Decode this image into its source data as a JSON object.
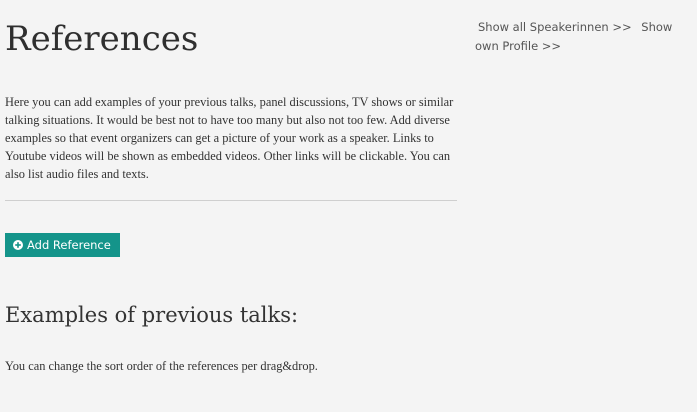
{
  "page": {
    "title": "References",
    "intro": "Here you can add examples of your previous talks, panel discussions, TV shows or similar talking situations. It would be best not to have too many but also not too few. Add diverse examples so that event organizers can get a picture of your work as a speaker. Links to Youtube videos will be shown as embedded videos. Other links will be clickable. You can also list audio files and texts.",
    "add_button_label": "Add Reference",
    "section_title": "Examples of previous talks:",
    "sort_hint": "You can change the sort order of the references per drag&drop."
  },
  "sidebar": {
    "show_all_link": "Show all Speakerinnen >>",
    "show_profile_link": "Show own Profile >>"
  },
  "icons": {
    "add_button_icon": "plus-circle-icon"
  },
  "colors": {
    "button_background": "#14948a",
    "button_text": "#ffffff",
    "page_background": "#f4f4f4"
  }
}
